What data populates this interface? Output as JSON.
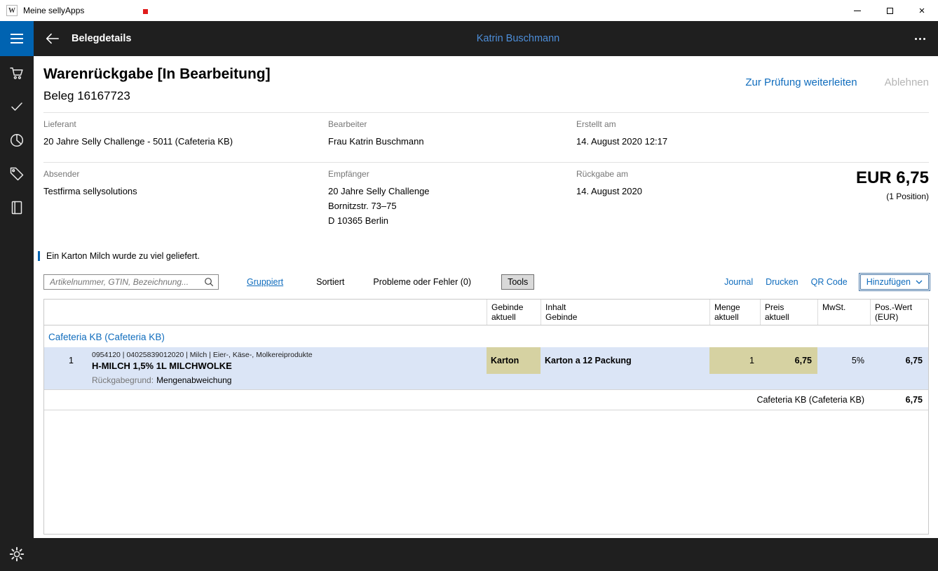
{
  "colors": {
    "accent": "#0063b1",
    "link": "#0f6cbd",
    "dark": "#1f1f1f",
    "row_highlight": "#dbe5f6",
    "cell_highlight": "#d6d2a2",
    "red": "#e01b1b",
    "header_user": "#4d8ed9",
    "disabled": "#b5b5b5"
  },
  "window": {
    "title": "Meine sellyApps",
    "icon_letter": "W"
  },
  "header": {
    "title": "Belegdetails",
    "user": "Katrin Buschmann"
  },
  "sidebar": {
    "icons": [
      "cart-icon",
      "check-icon",
      "pie-chart-icon",
      "tag-icon",
      "journal-icon"
    ],
    "bottom_icon": "settings-icon"
  },
  "document": {
    "title": "Warenrückgabe [In Bearbeitung]",
    "subtitle": "Beleg 16167723",
    "actions": {
      "forward": "Zur Prüfung weiterleiten",
      "reject": "Ablehnen"
    },
    "info": {
      "lieferant_label": "Lieferant",
      "lieferant": "20 Jahre Selly Challenge - 5011 (Cafeteria KB)",
      "bearbeiter_label": "Bearbeiter",
      "bearbeiter": "Frau Katrin Buschmann",
      "erstellt_label": "Erstellt am",
      "erstellt": "14. August 2020 12:17",
      "absender_label": "Absender",
      "absender": "Testfirma sellysolutions",
      "empfaenger_label": "Empfänger",
      "empfaenger_lines": [
        "20 Jahre Selly Challenge",
        "Bornitzstr. 73–75",
        "D 10365 Berlin"
      ],
      "rueckgabe_label": "Rückgabe am",
      "rueckgabe": "14. August 2020"
    },
    "total": {
      "amount": "EUR 6,75",
      "positions": "(1 Position)"
    },
    "note": "Ein Karton Milch wurde zu viel geliefert."
  },
  "toolbar": {
    "search_placeholder": "Artikelnummer, GTIN, Bezeichnung...",
    "grouped": "Gruppiert",
    "sorted": "Sortiert",
    "problems": "Probleme oder Fehler (0)",
    "tools": "Tools",
    "journal": "Journal",
    "print": "Drucken",
    "qr_code": "QR Code",
    "add": "Hinzufügen"
  },
  "table": {
    "columns": [
      {
        "label": ""
      },
      {
        "label": ""
      },
      {
        "label": "Gebinde\naktuell"
      },
      {
        "label": "Inhalt\nGebinde"
      },
      {
        "label": "Menge\naktuell"
      },
      {
        "label": "Preis\naktuell"
      },
      {
        "label": "MwSt."
      },
      {
        "label": "Pos.-Wert\n(EUR)"
      }
    ],
    "group": "Cafeteria KB (Cafeteria KB)",
    "rows": [
      {
        "index": "1",
        "meta": "0954120 | 04025839012020 | Milch | Eier-, Käse-, Molkereiprodukte",
        "name": "H-MILCH 1,5% 1L MILCHWOLKE",
        "gebinde": "Karton",
        "inhalt": "Karton a 12 Packung",
        "menge": "1",
        "preis": "6,75",
        "mwst": "5%",
        "pos_wert": "6,75",
        "reason_label": "Rückgabegrund:",
        "reason_value": "Mengenabweichung"
      }
    ],
    "summary": {
      "label": "Cafeteria KB (Cafeteria KB)",
      "value": "6,75"
    }
  }
}
